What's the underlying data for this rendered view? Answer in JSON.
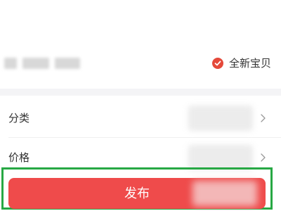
{
  "item": {
    "condition_label": "全新宝贝",
    "condition_icon": "check-circle-icon"
  },
  "form": {
    "category_label": "分类",
    "price_label": "价格"
  },
  "actions": {
    "publish_label": "发布"
  },
  "colors": {
    "accent_red": "#ef4b4b",
    "check_red": "#e5493a",
    "highlight_green": "#27a844",
    "divider_gray": "#f4f4f6"
  }
}
